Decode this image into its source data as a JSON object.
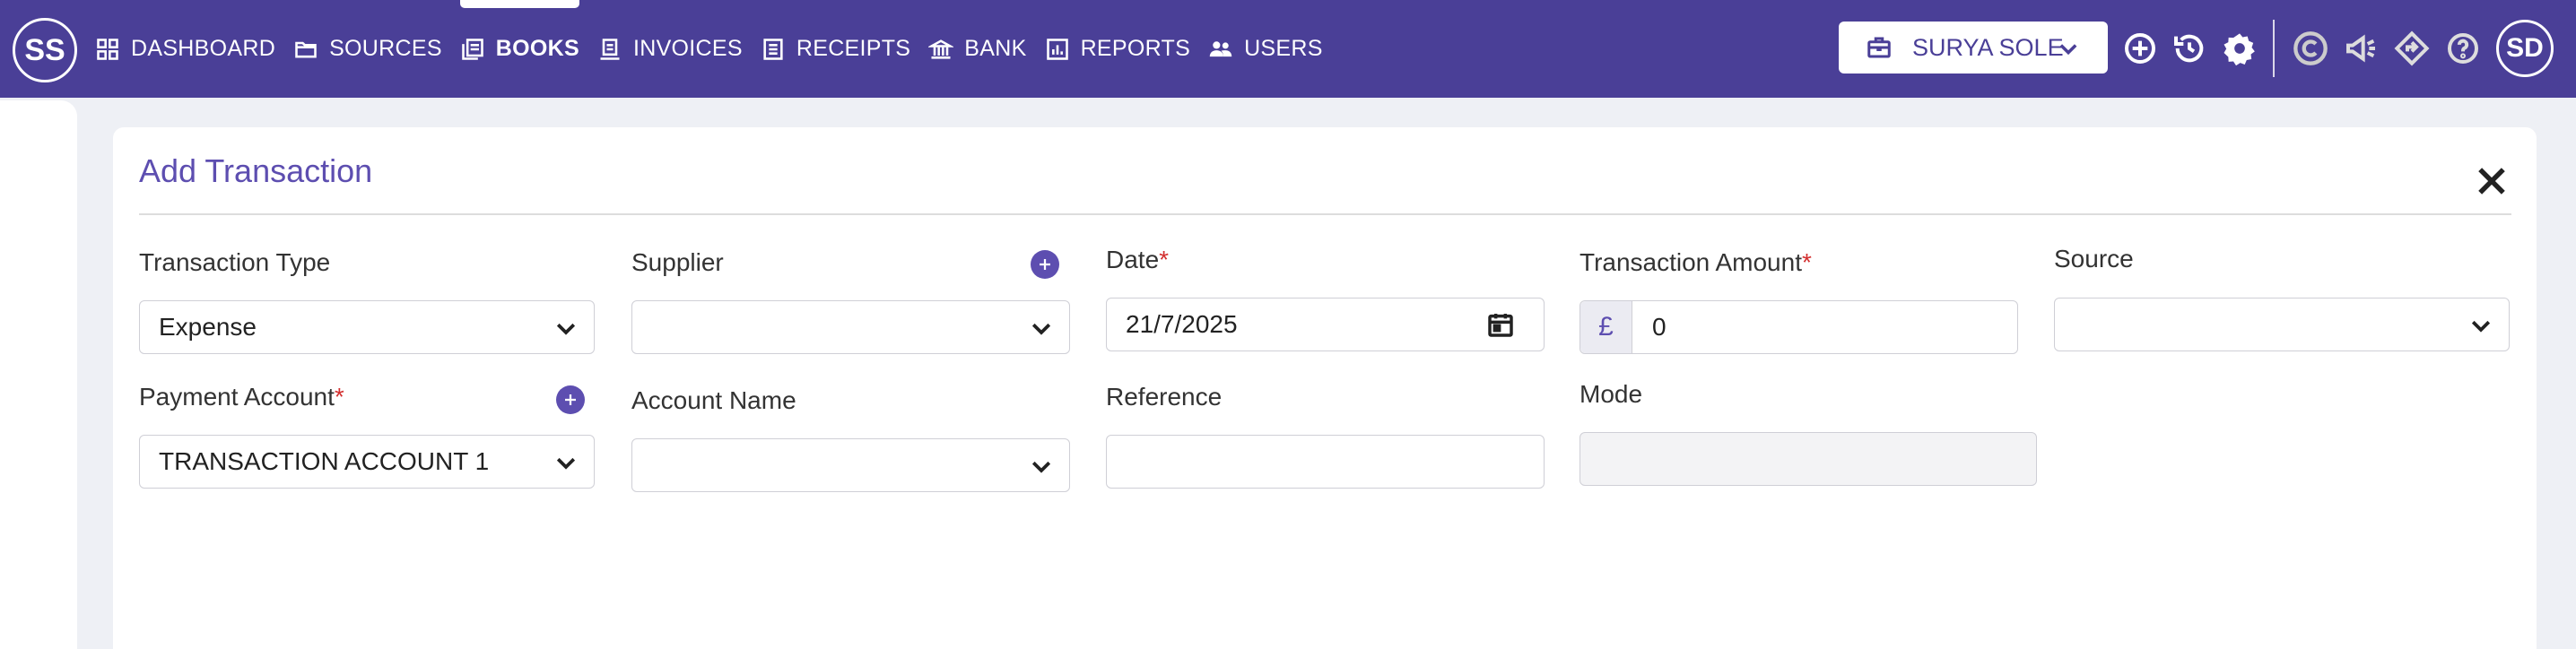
{
  "app": {
    "logo_initials": "SS",
    "user_initials": "SD"
  },
  "nav": {
    "items": [
      {
        "label": "DASHBOARD",
        "icon": "dashboard-icon"
      },
      {
        "label": "SOURCES",
        "icon": "folder-icon"
      },
      {
        "label": "BOOKS",
        "icon": "books-icon",
        "active": true
      },
      {
        "label": "INVOICES",
        "icon": "invoice-icon"
      },
      {
        "label": "RECEIPTS",
        "icon": "receipt-icon"
      },
      {
        "label": "BANK",
        "icon": "bank-icon"
      },
      {
        "label": "REPORTS",
        "icon": "reports-icon"
      },
      {
        "label": "USERS",
        "icon": "users-icon"
      }
    ]
  },
  "company_selector": {
    "value": "SURYA SOLE"
  },
  "toolbar_icons": [
    "add-circle-icon",
    "history-icon",
    "settings-icon",
    "c-brand-icon",
    "announcement-icon",
    "diamond-nav-icon",
    "help-icon"
  ],
  "form": {
    "title": "Add Transaction",
    "transaction_type": {
      "label": "Transaction Type",
      "value": "Expense"
    },
    "supplier": {
      "label": "Supplier",
      "value": ""
    },
    "date": {
      "label": "Date",
      "required_mark": "*",
      "value": "21/7/2025"
    },
    "transaction_amount": {
      "label": "Transaction Amount",
      "required_mark": "*",
      "currency": "£",
      "value": "0"
    },
    "source": {
      "label": "Source",
      "value": ""
    },
    "payment_account": {
      "label": "Payment Account",
      "required_mark": "*",
      "value": "TRANSACTION ACCOUNT 1"
    },
    "account_name": {
      "label": "Account Name",
      "value": ""
    },
    "reference": {
      "label": "Reference",
      "value": ""
    },
    "mode": {
      "label": "Mode",
      "value": ""
    }
  },
  "colors": {
    "topbar": "#4a3f97",
    "accent": "#5d4eb0",
    "required": "#d32f2f"
  }
}
